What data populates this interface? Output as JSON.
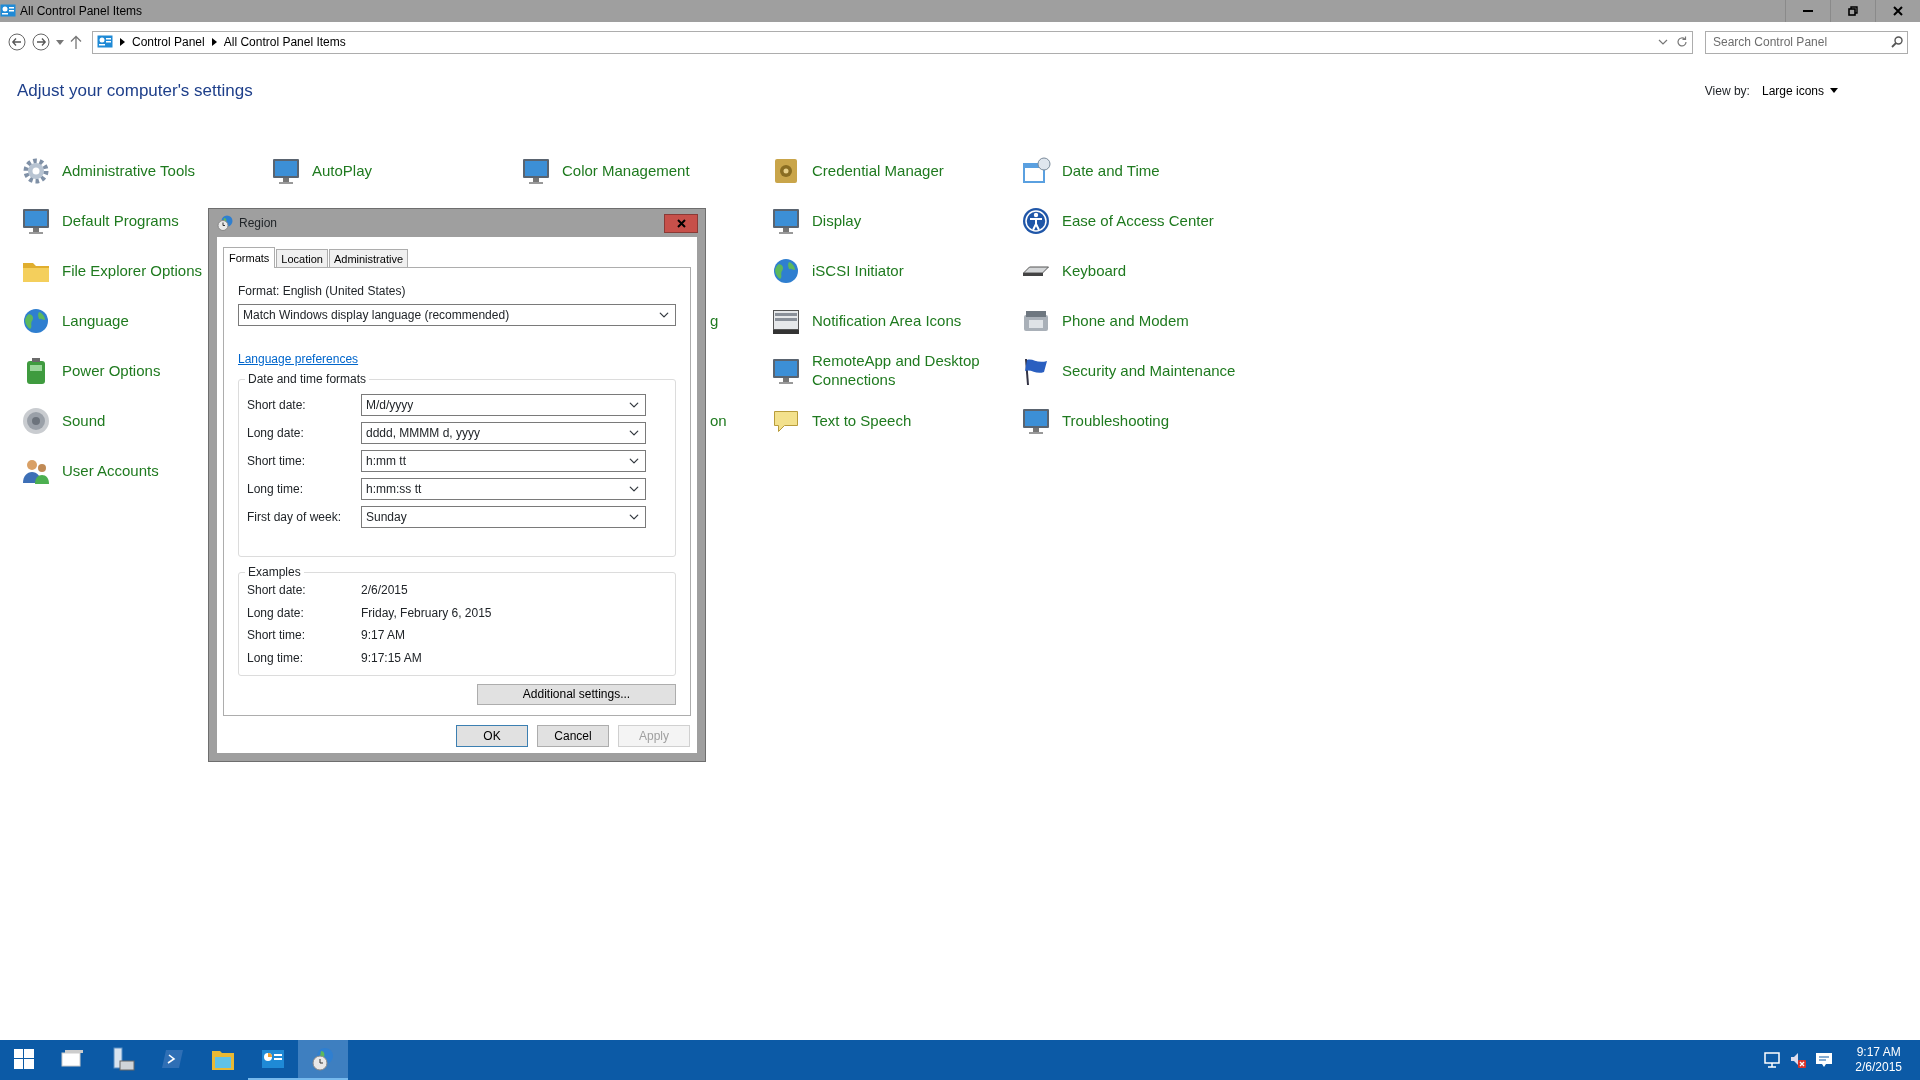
{
  "window": {
    "title": "All Control Panel Items"
  },
  "address": {
    "crumbs": [
      "Control Panel",
      "All Control Panel Items"
    ]
  },
  "search": {
    "placeholder": "Search Control Panel"
  },
  "heading": "Adjust your computer's settings",
  "view_by": {
    "label": "View by:",
    "value": "Large icons"
  },
  "columns": [
    [
      {
        "kind": "link",
        "label": "Administrative Tools"
      },
      {
        "kind": "link",
        "label": "Default Programs"
      },
      {
        "kind": "link",
        "label": "File Explorer Options"
      },
      {
        "kind": "link",
        "label": "Language"
      },
      {
        "kind": "link",
        "label": "Power Options"
      },
      {
        "kind": "link",
        "label": "Sound"
      },
      {
        "kind": "link",
        "label": "User Accounts"
      }
    ],
    [
      {
        "kind": "link",
        "label": "AutoPlay"
      }
    ],
    [
      {
        "kind": "link",
        "label": "Color Management"
      },
      {
        "kind": "covered"
      },
      {
        "kind": "covered"
      },
      {
        "kind": "fragment",
        "label": "g"
      },
      {
        "kind": "covered"
      },
      {
        "kind": "fragment",
        "label": "on"
      }
    ],
    [
      {
        "kind": "link",
        "label": "Credential Manager"
      },
      {
        "kind": "link",
        "label": "Display"
      },
      {
        "kind": "link",
        "label": "iSCSI Initiator"
      },
      {
        "kind": "link",
        "label": "Notification Area Icons"
      },
      {
        "kind": "link",
        "label": "RemoteApp and Desktop Connections"
      },
      {
        "kind": "link",
        "label": "Text to Speech"
      }
    ],
    [
      {
        "kind": "link",
        "label": "Date and Time"
      },
      {
        "kind": "link",
        "label": "Ease of Access Center"
      },
      {
        "kind": "link",
        "label": "Keyboard"
      },
      {
        "kind": "link",
        "label": "Phone and Modem"
      },
      {
        "kind": "link",
        "label": "Security and Maintenance"
      },
      {
        "kind": "link",
        "label": "Troubleshooting"
      }
    ]
  ],
  "dialog": {
    "title": "Region",
    "tabs": [
      {
        "label": "Formats",
        "selected": true
      },
      {
        "label": "Location",
        "selected": false
      },
      {
        "label": "Administrative",
        "selected": false
      }
    ],
    "format_label": "Format: English (United States)",
    "format_value": "Match Windows display language (recommended)",
    "link": "Language preferences",
    "formats": {
      "title": "Date and time formats",
      "rows": [
        {
          "label": "Short date:",
          "value": "M/d/yyyy"
        },
        {
          "label": "Long date:",
          "value": "dddd, MMMM d, yyyy"
        },
        {
          "label": "Short time:",
          "value": "h:mm tt"
        },
        {
          "label": "Long time:",
          "value": "h:mm:ss tt"
        },
        {
          "label": "First day of week:",
          "value": "Sunday"
        }
      ]
    },
    "examples": {
      "title": "Examples",
      "rows": [
        {
          "label": "Short date:",
          "value": "2/6/2015"
        },
        {
          "label": "Long date:",
          "value": "Friday, February 6, 2015"
        },
        {
          "label": "Short time:",
          "value": "9:17 AM"
        },
        {
          "label": "Long time:",
          "value": "9:17:15 AM"
        }
      ]
    },
    "additional_button": "Additional settings...",
    "buttons": [
      {
        "label": "OK",
        "disabled": false
      },
      {
        "label": "Cancel",
        "disabled": false
      },
      {
        "label": "Apply",
        "disabled": true
      }
    ]
  },
  "taskbar": {
    "apps": [
      {
        "selected": false,
        "running": false
      },
      {
        "selected": false,
        "running": false
      },
      {
        "selected": false,
        "running": false
      },
      {
        "selected": false,
        "running": false
      },
      {
        "selected": false,
        "running": true
      },
      {
        "selected": true,
        "running": true
      }
    ],
    "clock": {
      "time": "9:17 AM",
      "date": "2/6/2015"
    }
  }
}
